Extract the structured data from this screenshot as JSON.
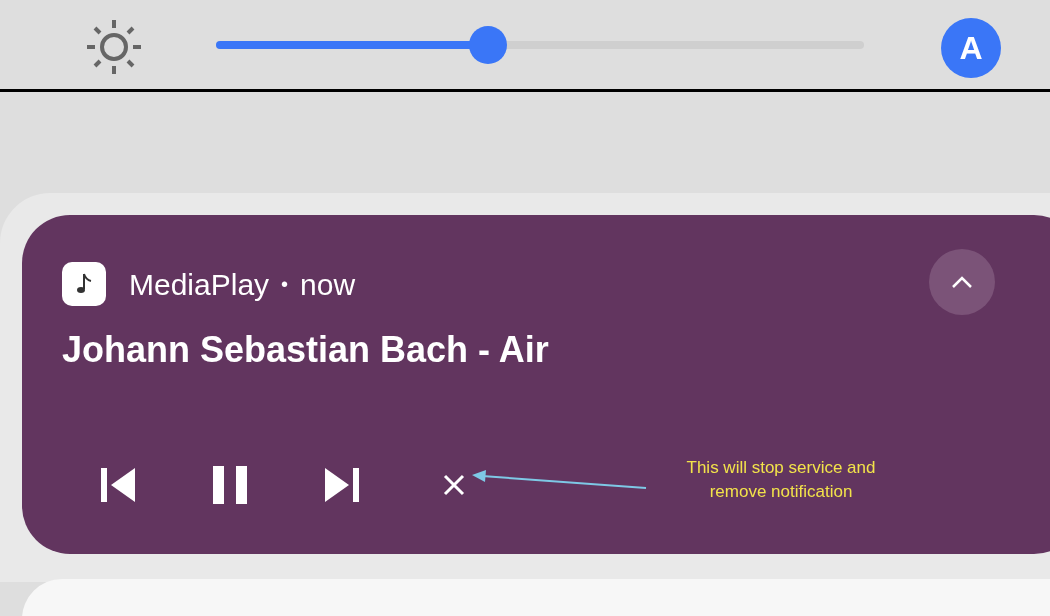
{
  "brightness": {
    "level": 0.42
  },
  "auto_brightness": {
    "label": "A",
    "on": true
  },
  "notification": {
    "app": "MediaPlay",
    "separator": "•",
    "time": "now",
    "title": "Johann Sebastian Bach - Air",
    "expanded": true,
    "controls": [
      {
        "kind": "previous"
      },
      {
        "kind": "pause"
      },
      {
        "kind": "next"
      },
      {
        "kind": "close"
      }
    ],
    "annotation": "This will stop service and remove notification"
  }
}
